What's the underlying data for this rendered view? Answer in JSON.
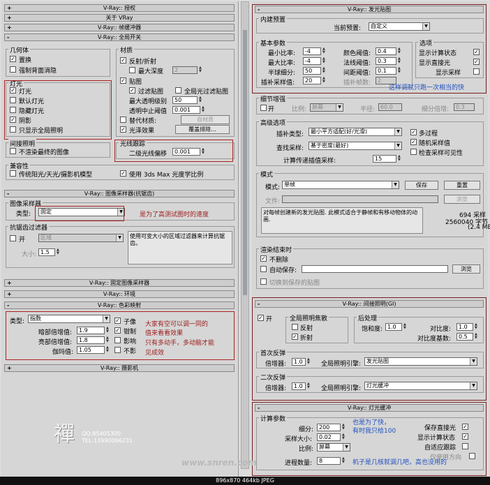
{
  "left": {
    "rollouts_top": [
      {
        "sign": "+",
        "label": "V-Ray:: 授权"
      },
      {
        "sign": "+",
        "label": "关于 VRay"
      },
      {
        "sign": "+",
        "label": "V-Ray:: 帧缓冲器"
      },
      {
        "sign": "-",
        "label": "V-Ray:: 全局开关"
      }
    ],
    "geometry": {
      "title": "几何体",
      "displacement": "置换",
      "backface": "强制背面消隐"
    },
    "lighting": {
      "title": "灯光",
      "lights": "灯光",
      "default_lights": "默认灯光",
      "hidden_lights": "隐藏灯光",
      "shadows": "阴影",
      "gi_only": "只显示全局照明"
    },
    "indirect": {
      "title": "间接照明",
      "no_final": "不渲染最终的图像"
    },
    "compat": {
      "title": "兼容性",
      "legacy": "传统阳光/天光/摄影机模型",
      "use_3dsmax": "使用 3ds Max 光度学比例"
    },
    "materials": {
      "title": "材质",
      "refl_refr": "反射/折射",
      "max_depth": "最大深度",
      "max_depth_val": "2",
      "maps": "贴图",
      "filter_maps": "过滤贴图",
      "gi_filter": "全局光过滤贴图",
      "max_transp": "最大透明级别",
      "max_transp_val": "50",
      "transp_cutoff": "透明中止阈值",
      "transp_cutoff_val": "0.001",
      "override_mtl": "替代材质:",
      "override_btn": "自材质",
      "glossy": "光泽效果",
      "glossy_btn": "覆盖排除..."
    },
    "raytrace": {
      "title": "光线跟踪",
      "secondary_bias": "二级光线偏移",
      "bias_val": "0.001"
    },
    "image_sampler_rollout": {
      "sign": "-",
      "label": "V-Ray:: 图像采样器(抗锯齿)"
    },
    "image_sampler": {
      "title": "图像采样器",
      "type_label": "类型:",
      "type_value": "固定"
    },
    "note_sampler": "是为了高测试图时的速度",
    "aa_filter": {
      "title": "抗锯齿过滤器",
      "on": "开",
      "filter_value": "区域",
      "size_label": "大小:",
      "size_val": "1.5",
      "desc": "使用可变大小的区域过滤器来计算抗锯齿。"
    },
    "rollouts_mid": [
      {
        "sign": "+",
        "label": "V-Ray:: 固定图像采样器"
      },
      {
        "sign": "+",
        "label": "V-Ray:: 环境"
      },
      {
        "sign": "-",
        "label": "V-Ray:: 色彩映射"
      }
    ],
    "color_mapping": {
      "type_label": "类型:",
      "type_value": "指数",
      "dark_label": "暗部倍增值:",
      "dark_val": "1.9",
      "bright_label": "亮部倍增值:",
      "bright_val": "1.8",
      "gamma_label": "伽玛值:",
      "gamma_val": "1.05",
      "sub_pixel": "子像",
      "clamp": "钳制",
      "affect": "影响",
      "no_bg": "不影"
    },
    "note_color": [
      "大家有空可以调一同的",
      "值来看看效果",
      "只有多动手，多动脑才能",
      "见成效"
    ],
    "camera_rollout": {
      "sign": "+",
      "label": "V-Ray:: 摄影机"
    },
    "sig_char": "禪",
    "sig_lines": [
      "QQ:85405300",
      "TEL:13990066231"
    ]
  },
  "right": {
    "irradiance_rollout": {
      "sign": "-",
      "label": "V-Ray:: 发光贴图"
    },
    "preset": {
      "title": "内建预置",
      "label": "当前预置:",
      "value": "自定义"
    },
    "basic": {
      "title": "基本参数",
      "min_rate": "最小比率:",
      "min_rate_val": "-4",
      "max_rate": "最大比率:",
      "max_rate_val": "-4",
      "hsph": "半球细分:",
      "hsph_val": "50",
      "interp": "插补采样值:",
      "interp_val": "20",
      "clr_thresh": "颜色阈值:",
      "clr_thresh_val": "0.4",
      "nrm_thresh": "法线阈值:",
      "nrm_thresh_val": "0.3",
      "dist_thresh": "间距阈值:",
      "dist_thresh_val": "0.1",
      "interp_frames": "插补帧数:",
      "interp_frames_val": "2"
    },
    "options": {
      "title": "选项",
      "show_calc": "显示计算状态",
      "show_direct": "显示直接光",
      "show_samples": "显示采样"
    },
    "note_blue1": "这样调就只跑一次相当的快",
    "detail": {
      "title": "细节增强",
      "on": "开",
      "scale_label": "比例:",
      "scale_val": "屏幕",
      "radius_label": "半径:",
      "radius_val": "60.0",
      "mult_label": "细分倍增:",
      "mult_val": "0.3"
    },
    "advanced": {
      "title": "高级选项",
      "interp_type": "插补类型:",
      "interp_type_val": "最小平方适配(好/光滑)",
      "lookup": "查找采样:",
      "lookup_val": "基于密度(最好)",
      "calc_pass": "计算传递插值采样:",
      "calc_pass_val": "15",
      "multipass": "多过程",
      "randomize": "随机采样值",
      "check_vis": "检查采样可见性"
    },
    "mode": {
      "title": "模式",
      "mode_label": "模式:",
      "mode_val": "单帧",
      "save": "保存",
      "reset": "重置",
      "file_label": "文件:",
      "browse": "浏览",
      "desc": "对每帧创建新的发光贴图. 此模式适合于静帧和有移动物体的动画.",
      "samples": "694 采样",
      "bytes": "2560040 字节",
      "mb": "(2.4 MB)"
    },
    "on_render_end": {
      "title": "渲染结束时",
      "no_delete": "不删除",
      "auto_save": "自动保存:",
      "browse": "浏览",
      "switch_saved": "切换到保存的贴图"
    },
    "gi_rollout": {
      "sign": "-",
      "label": "V-Ray:: 间接照明(GI)"
    },
    "gi": {
      "on": "开",
      "caustics_title": "全局照明焦散",
      "reflective": "反射",
      "refractive": "折射",
      "post_title": "后处理",
      "saturation": "饱和度:",
      "saturation_val": "1.0",
      "contrast": "对比度:",
      "contrast_val": "1.0",
      "contrast_base": "对比度基数:",
      "contrast_base_val": "0.5",
      "primary_title": "首次反弹",
      "mult": "倍增器:",
      "primary_mult": "1.0",
      "engine": "全局照明引擎:",
      "primary_engine": "发光贴图",
      "secondary_title": "二次反弹",
      "secondary_mult": "1.0",
      "secondary_engine": "灯光缓冲"
    },
    "lc_rollout": {
      "sign": "-",
      "label": "V-Ray:: 灯光缓冲"
    },
    "lc": {
      "title": "计算参数",
      "subdivs": "细分:",
      "subdivs_val": "200",
      "sample_size": "采样大小:",
      "sample_size_val": "0.02",
      "scale": "比例:",
      "scale_val": "屏幕",
      "passes": "进程数量:",
      "passes_val": "8",
      "store_direct": "保存直接光",
      "show_calc": "显示计算状态",
      "adaptive": "自适应跟踪",
      "dirs_only": "仅使用方向"
    },
    "note_blue2": [
      "也是为了快，",
      "有时我只给100"
    ],
    "note_blue3": "机子是几核就调几吧，高也没用的"
  },
  "watermark": "www.snren.com",
  "status": "896x870  464kb  JPEG"
}
